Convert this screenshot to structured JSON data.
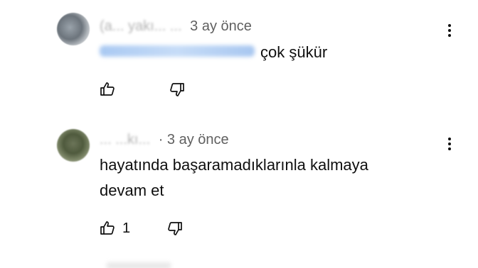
{
  "comments": [
    {
      "author": "(a... yakı... ...",
      "time": "3 ay önce",
      "text_suffix": "çok şükür",
      "like_count": ""
    },
    {
      "author": "... ...kı...",
      "time": "· 3 ay önce",
      "text_line1": "hayatında başaramadıklarınla kalmaya",
      "text_line2": "devam et",
      "like_count": "1"
    }
  ],
  "icons": {
    "like": "thumbs-up-icon",
    "dislike": "thumbs-down-icon",
    "menu": "more-vertical-icon"
  }
}
